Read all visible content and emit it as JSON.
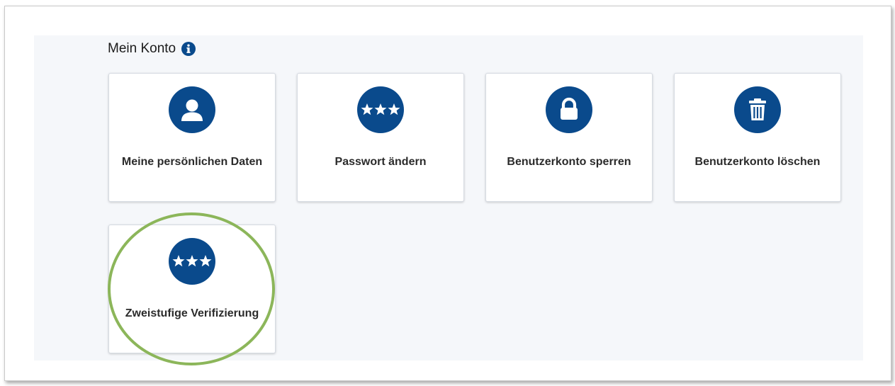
{
  "section": {
    "title": "Mein Konto",
    "info_icon": "info-icon"
  },
  "tiles": [
    {
      "label": "Meine persönlichen Daten",
      "icon": "user-icon"
    },
    {
      "label": "Passwort ändern",
      "icon": "password-stars-icon"
    },
    {
      "label": "Benutzerkonto sperren",
      "icon": "lock-icon"
    },
    {
      "label": "Benutzerkonto löschen",
      "icon": "trash-icon"
    },
    {
      "label": "Zweistufige Verifizierung",
      "icon": "password-stars-icon"
    }
  ],
  "colors": {
    "icon_circle": "#0a4a8c",
    "highlight_ring": "#8cb65a",
    "panel_bg": "#f5f7fa"
  }
}
